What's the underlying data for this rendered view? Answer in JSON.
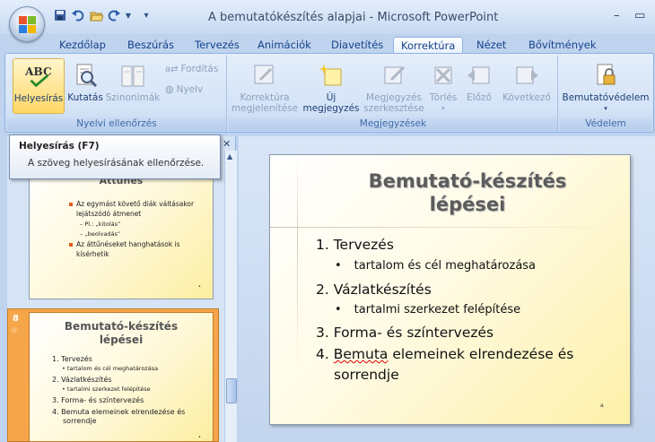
{
  "window": {
    "title": "A bemutatókészítés alapjai - Microsoft PowerPoint"
  },
  "quick_access": {
    "save_icon": "save-icon",
    "undo_icon": "undo-icon",
    "open_icon": "open-folder-icon",
    "redo_icon": "redo-icon",
    "customize_icon": "customize-qat-icon"
  },
  "tabs": [
    "Kezdőlap",
    "Beszúrás",
    "Tervezés",
    "Animációk",
    "Diavetítés",
    "Korrektúra",
    "Nézet",
    "Bővítmények"
  ],
  "active_tab": "Korrektúra",
  "ribbon": {
    "proofing": {
      "label": "Nyelvi ellenőrzés",
      "spelling": "Helyesírás",
      "research": "Kutatás",
      "thesaurus": "Szinonimák",
      "translate": "Fordítás",
      "language": "Nyelv"
    },
    "comments": {
      "label": "Megjegyzések",
      "show_markup_1": "Korrektúra",
      "show_markup_2": "megjelenítése",
      "new_comment_1": "Új",
      "new_comment_2": "megjegyzés",
      "edit_comment_1": "Megjegyzés",
      "edit_comment_2": "szerkesztése",
      "delete": "Törlés",
      "previous": "Előző",
      "next": "Következő"
    },
    "protect": {
      "label": "Védelem",
      "protect_presentation": "Bemutatóvédelem"
    }
  },
  "tooltip": {
    "title": "Helyesírás (F7)",
    "description": "A szöveg helyesírásának ellenőrzése."
  },
  "slides_pane": {
    "slide7": {
      "title_partial": "Áttűnés",
      "bullet1_a": "Az egymást követő diák váltásakor",
      "bullet1_b": "lejátszódó átmenet",
      "sub1": "– Pl.: „kitolás”",
      "sub2": "– „beolvadás”",
      "bullet2_a": "Az áttűnéseket hanghatások is",
      "bullet2_b": "kísérhetik"
    },
    "slide8": {
      "number": "8",
      "title_1": "Bemutató-készítés",
      "title_2": "lépései",
      "item1": "1. Tervezés",
      "sub1": "•  tartalom és cél meghatározása",
      "item2": "2. Vázlatkészítés",
      "sub2": "•  tartalmi szerkezet felépítése",
      "item3": "3. Forma- és színtervezés",
      "item4_a": "4. Bemuta elemeinek elrendezése és",
      "item4_b": "sorrendje"
    }
  },
  "slide": {
    "title_1": "Bemutató-készítés",
    "title_2": "lépései",
    "item1": "1. Tervezés",
    "sub1": "tartalom és cél meghatározása",
    "item2": "2. Vázlatkészítés",
    "sub2": "tartalmi szerkezet felépítése",
    "item3": "3. Forma- és színtervezés",
    "item4_num": "4.",
    "item4_word": "Bemuta",
    "item4_rest": "elemeinek elrendezése és",
    "item4_b": "sorrendje"
  },
  "colors": {
    "accent": "#e35b1a",
    "ribbon_text": "#15428b"
  }
}
